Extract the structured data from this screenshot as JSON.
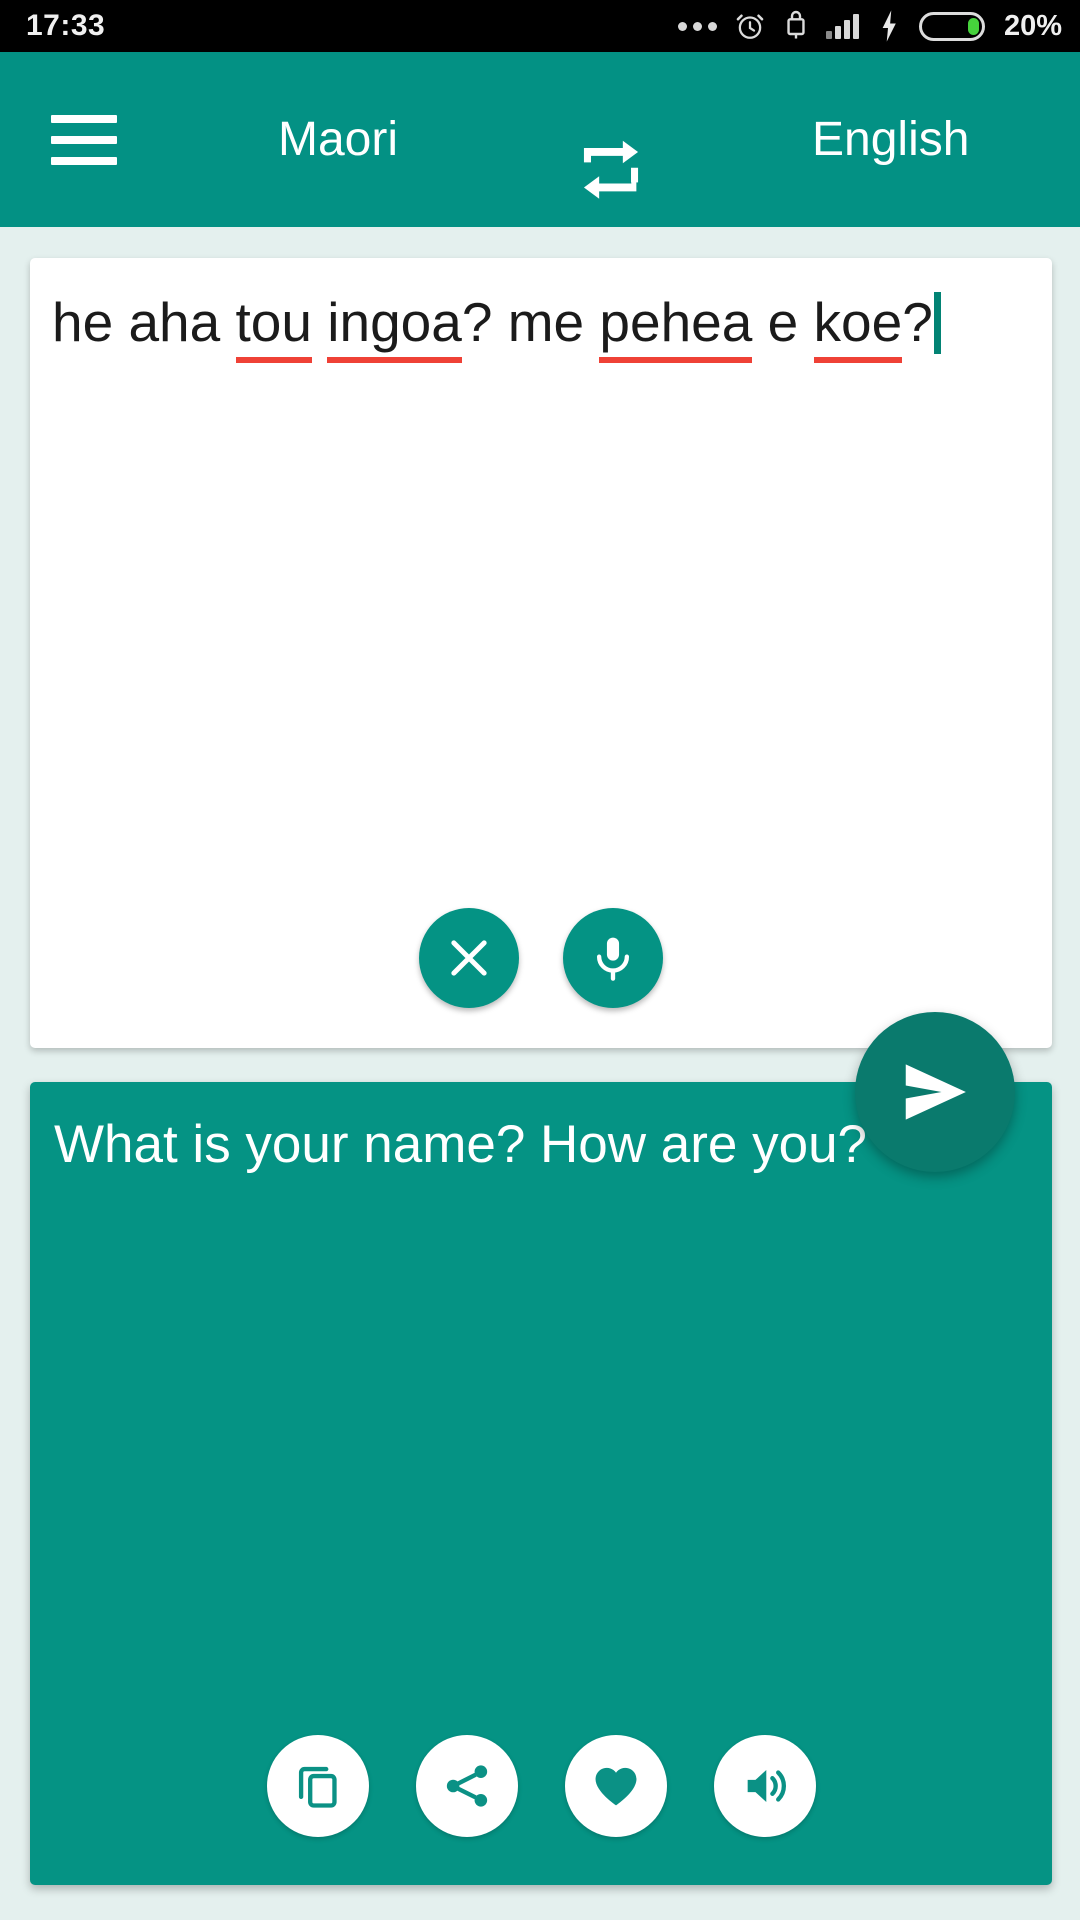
{
  "status_bar": {
    "time": "17:33",
    "battery_percent": "20%",
    "battery_level": 20,
    "icons": [
      "more-dots-icon",
      "alarm-clock-icon",
      "usb-lock-icon",
      "signal-bars-icon",
      "charging-bolt-icon",
      "battery-icon"
    ],
    "colors": {
      "background": "#000000",
      "text": "#f0f0f0",
      "battery_fill": "#46d23c"
    }
  },
  "app_bar": {
    "menu_icon": "hamburger-menu-icon",
    "source_language": "Maori",
    "swap_icon": "swap-languages-icon",
    "target_language": "English",
    "color": "#039184"
  },
  "source_card": {
    "text": "he aha tou ingoa? me pehea e koe?",
    "tokens": [
      {
        "text": "he ",
        "misspelled": false
      },
      {
        "text": "aha ",
        "misspelled": false
      },
      {
        "text": "tou",
        "misspelled": true
      },
      {
        "text": " ",
        "misspelled": false
      },
      {
        "text": "ingoa",
        "misspelled": true
      },
      {
        "text": "? me ",
        "misspelled": false
      },
      {
        "text": "pehea",
        "misspelled": true
      },
      {
        "text": " e ",
        "misspelled": false
      },
      {
        "text": "koe",
        "misspelled": true
      },
      {
        "text": "?",
        "misspelled": false
      }
    ],
    "caret_visible": true,
    "buttons": [
      {
        "name": "clear-button",
        "icon": "close-x-icon"
      },
      {
        "name": "microphone-button",
        "icon": "microphone-icon"
      }
    ],
    "colors": {
      "background": "#ffffff",
      "text": "#1b1b1b",
      "spellcheck_underline": "#ef4136",
      "caret": "#028374",
      "button": "#049384"
    }
  },
  "send_button": {
    "name": "send-button",
    "icon": "send-paper-plane-icon",
    "color": "#0a7a6d"
  },
  "target_card": {
    "text": "What is your name? How are you?",
    "buttons": [
      {
        "name": "copy-button",
        "icon": "copy-icon"
      },
      {
        "name": "share-button",
        "icon": "share-icon"
      },
      {
        "name": "favorite-button",
        "icon": "heart-icon"
      },
      {
        "name": "speak-button",
        "icon": "speaker-volume-icon"
      }
    ],
    "colors": {
      "background": "#059384",
      "text": "#ffffff",
      "button_bg": "#ffffff",
      "button_icon": "#0b9185"
    }
  },
  "page": {
    "background": "#e4f0ee"
  }
}
